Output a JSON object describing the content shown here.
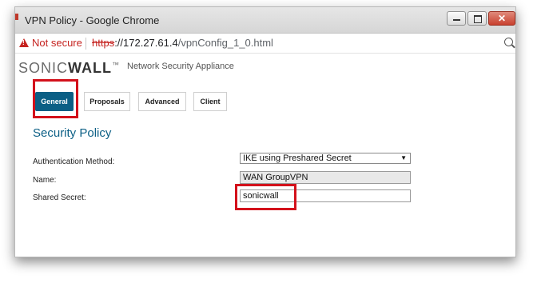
{
  "window": {
    "title": "VPN Policy - Google Chrome",
    "close_glyph": "✕"
  },
  "addressbar": {
    "security_label": "Not secure",
    "url_scheme": "https",
    "url_host": "://172.27.61.4",
    "url_path": "/vpnConfig_1_0.html"
  },
  "header": {
    "logo_part1": "SONIC",
    "logo_part2": "WALL",
    "logo_tm": "™",
    "subtitle": "Network Security Appliance"
  },
  "tabs": [
    {
      "label": "General",
      "active": true
    },
    {
      "label": "Proposals",
      "active": false
    },
    {
      "label": "Advanced",
      "active": false
    },
    {
      "label": "Client",
      "active": false
    }
  ],
  "section_title": "Security Policy",
  "form": {
    "auth_method_label": "Authentication Method:",
    "auth_method_value": "IKE using Preshared Secret",
    "dropdown_arrow": "▼",
    "name_label": "Name:",
    "name_value": "WAN GroupVPN",
    "shared_secret_label": "Shared Secret:",
    "shared_secret_value": "sonicwall"
  },
  "colors": {
    "accent": "#0b5f85",
    "highlight": "#d3111b",
    "warning": "#c5221f"
  }
}
